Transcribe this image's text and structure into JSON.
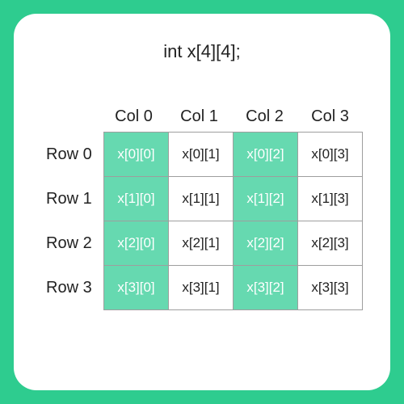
{
  "declaration": "int x[4][4];",
  "col_headers": [
    "Col 0",
    "Col 1",
    "Col 2",
    "Col 3"
  ],
  "row_headers": [
    "Row 0",
    "Row 1",
    "Row 2",
    "Row 3"
  ],
  "cells": [
    [
      "x[0][0]",
      "x[0][1]",
      "x[0][2]",
      "x[0][3]"
    ],
    [
      "x[1][0]",
      "x[1][1]",
      "x[1][2]",
      "x[1][3]"
    ],
    [
      "x[2][0]",
      "x[2][1]",
      "x[2][2]",
      "x[2][3]"
    ],
    [
      "x[3][0]",
      "x[3][1]",
      "x[3][2]",
      "x[3][3]"
    ]
  ],
  "highlighted_columns": [
    0,
    2
  ],
  "colors": {
    "background": "#2ecc8f",
    "highlight": "#66d9b0",
    "card": "#ffffff"
  }
}
